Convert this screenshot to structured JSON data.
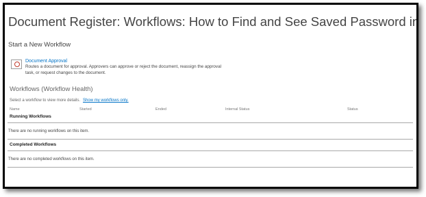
{
  "page": {
    "title": "Document Register: Workflows: How to Find and See Saved Password in the"
  },
  "start_section": {
    "heading": "Start a New Workflow",
    "template_name": "Document Approval",
    "template_description": "Routes a document for approval. Approvers can approve or reject the document, reassign the approval task, or request changes to the document.",
    "icon": "approval-workflow-icon"
  },
  "workflows_section": {
    "heading": "Workflows  (Workflow Health)",
    "hint": "Select a workflow to view more details.",
    "filter_link": "Show my workflows only.",
    "columns": [
      "Name",
      "Started",
      "Ended",
      "Internal Status",
      "Status"
    ],
    "running": {
      "label": "Running Workflows",
      "empty_message": "There are no running workflows on this item."
    },
    "completed": {
      "label": "Completed Workflows",
      "empty_message": "There are no completed workflows on this item."
    }
  },
  "colors": {
    "link": "#0072c6",
    "text": "#444444",
    "border": "#000000"
  }
}
